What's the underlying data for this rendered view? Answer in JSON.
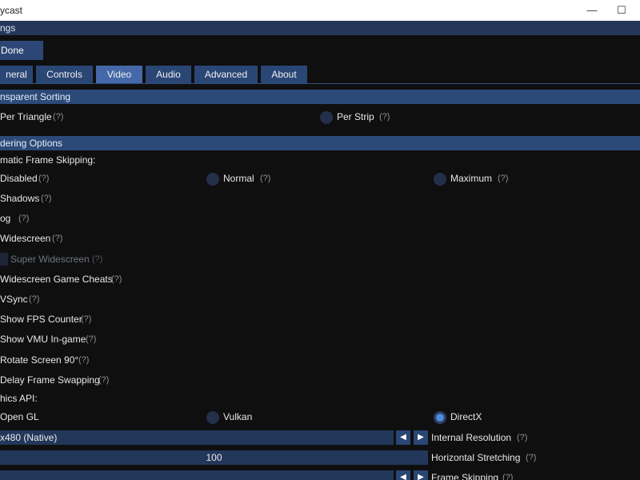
{
  "window": {
    "title": "ycast",
    "minimize_icon": "minimize-icon",
    "maximize_icon": "maximize-icon"
  },
  "header": {
    "title": "ngs"
  },
  "done_button": {
    "label": "Done"
  },
  "tabs": [
    {
      "label": "neral"
    },
    {
      "label": "Controls"
    },
    {
      "label": "Video"
    },
    {
      "label": "Audio"
    },
    {
      "label": "Advanced"
    },
    {
      "label": "About"
    }
  ],
  "transparent_sorting": {
    "header": "nsparent Sorting",
    "per_triangle": {
      "label": "Per Triangle",
      "help": "(?)"
    },
    "per_strip": {
      "label": "Per Strip",
      "help": "(?)"
    }
  },
  "rendering": {
    "header": "dering Options",
    "frame_skip_label": "matic Frame Skipping:",
    "disabled": {
      "label": "Disabled",
      "help": "(?)"
    },
    "normal": {
      "label": "Normal",
      "help": "(?)"
    },
    "maximum": {
      "label": "Maximum",
      "help": "(?)"
    },
    "shadows": {
      "label": "Shadows",
      "help": "(?)"
    },
    "fog": {
      "label": "og",
      "help": "(?)"
    },
    "widescreen": {
      "label": "Widescreen",
      "help": "(?)"
    },
    "super_widescreen": {
      "label": "Super Widescreen",
      "help": "(?)"
    },
    "widescreen_cheats": {
      "label": "Widescreen Game Cheats",
      "help": "(?)"
    },
    "vsync": {
      "label": "VSync",
      "help": "(?)"
    },
    "fps_counter": {
      "label": "Show FPS Counter",
      "help": "(?)"
    },
    "vmu_ingame": {
      "label": "Show VMU In-game",
      "help": "(?)"
    },
    "rotate_screen": {
      "label": "Rotate Screen 90°",
      "help": "(?)"
    },
    "delay_swap": {
      "label": "Delay Frame Swapping",
      "help": "(?)"
    },
    "graphics_api_label": "hics API:",
    "opengl": {
      "label": "Open GL"
    },
    "vulkan": {
      "label": "Vulkan"
    },
    "directx": {
      "label": "DirectX"
    },
    "internal_resolution": {
      "value": "x480 (Native)",
      "label": "Internal Resolution",
      "help": "(?)"
    },
    "horizontal_stretching": {
      "value": "100",
      "label": "Horizontal Stretching",
      "help": "(?)"
    },
    "frame_skipping": {
      "label": "Frame Skipping",
      "help": "(?)"
    }
  },
  "colors": {
    "accent": "#4d8ad9",
    "header_bg": "#2c4a78",
    "tab_bg": "#2a4675",
    "tab_active": "#4468a8"
  }
}
